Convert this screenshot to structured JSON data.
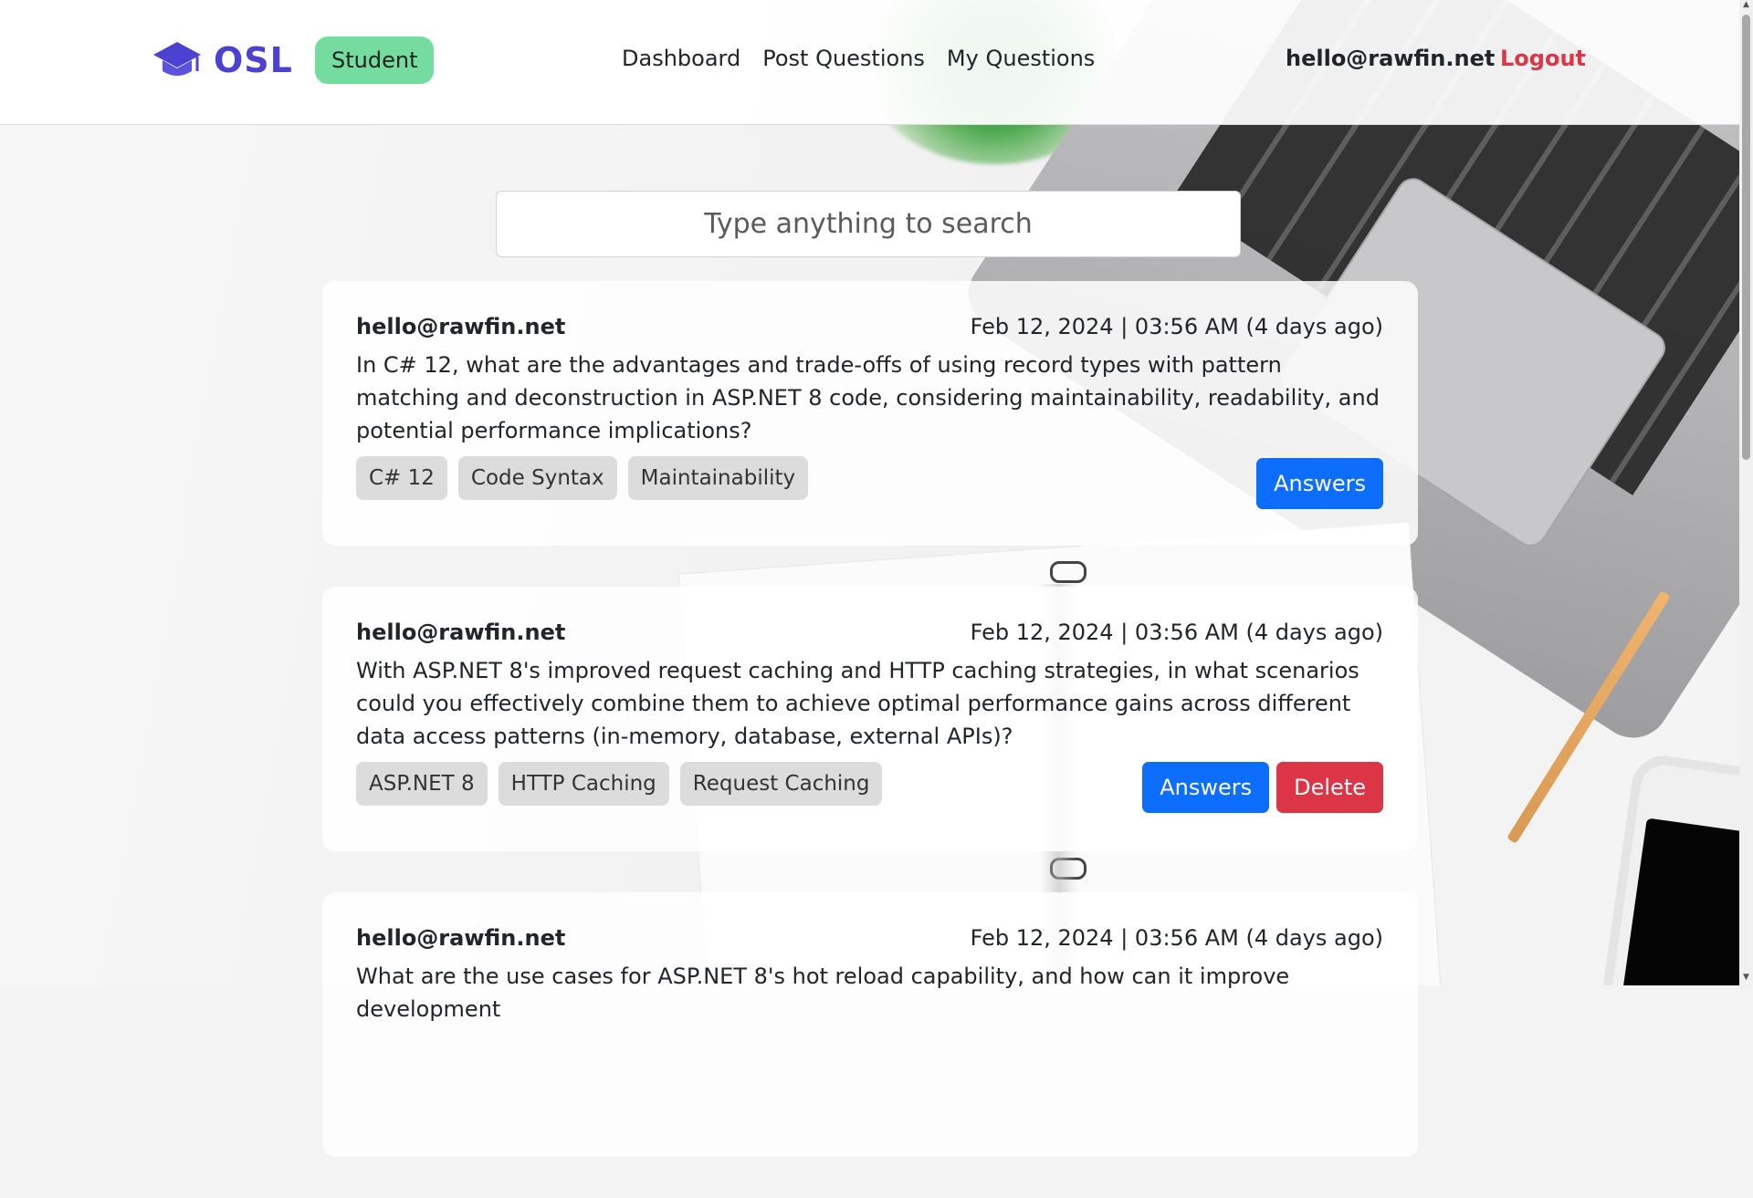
{
  "brand": {
    "name": "OSL",
    "logo_icon": "graduation-cap-icon",
    "color": "#4b42d1"
  },
  "header": {
    "role_badge": "Student",
    "nav": [
      {
        "label": "Dashboard"
      },
      {
        "label": "Post Questions"
      },
      {
        "label": "My Questions"
      }
    ],
    "user_email": "hello@rawfin.net",
    "logout_label": "Logout"
  },
  "search": {
    "placeholder": "Type anything to search",
    "value": ""
  },
  "questions": [
    {
      "author": "hello@rawfin.net",
      "date": "Feb 12, 2024 | 03:56 AM (4 days ago)",
      "text": "In C# 12, what are the advantages and trade-offs of using record types with pattern matching and deconstruction in ASP.NET 8 code, considering maintainability, readability, and potential performance implications?",
      "tags": [
        "C# 12",
        "Code Syntax",
        "Maintainability"
      ],
      "answers_label": "Answers"
    },
    {
      "author": "hello@rawfin.net",
      "date": "Feb 12, 2024 | 03:56 AM (4 days ago)",
      "text": "With ASP.NET 8's improved request caching and HTTP caching strategies, in what scenarios could you effectively combine them to achieve optimal performance gains across different data access patterns (in-memory, database, external APIs)?",
      "tags": [
        "ASP.NET 8",
        "HTTP Caching",
        "Request Caching"
      ],
      "answers_label": "Answers",
      "delete_label": "Delete"
    },
    {
      "author": "hello@rawfin.net",
      "date": "Feb 12, 2024 | 03:56 AM (4 days ago)",
      "text": "What are the use cases for ASP.NET 8's hot reload capability, and how can it improve development"
    }
  ],
  "colors": {
    "primary": "#0d6efd",
    "danger": "#dc3545",
    "badge": "#75dc9f"
  }
}
